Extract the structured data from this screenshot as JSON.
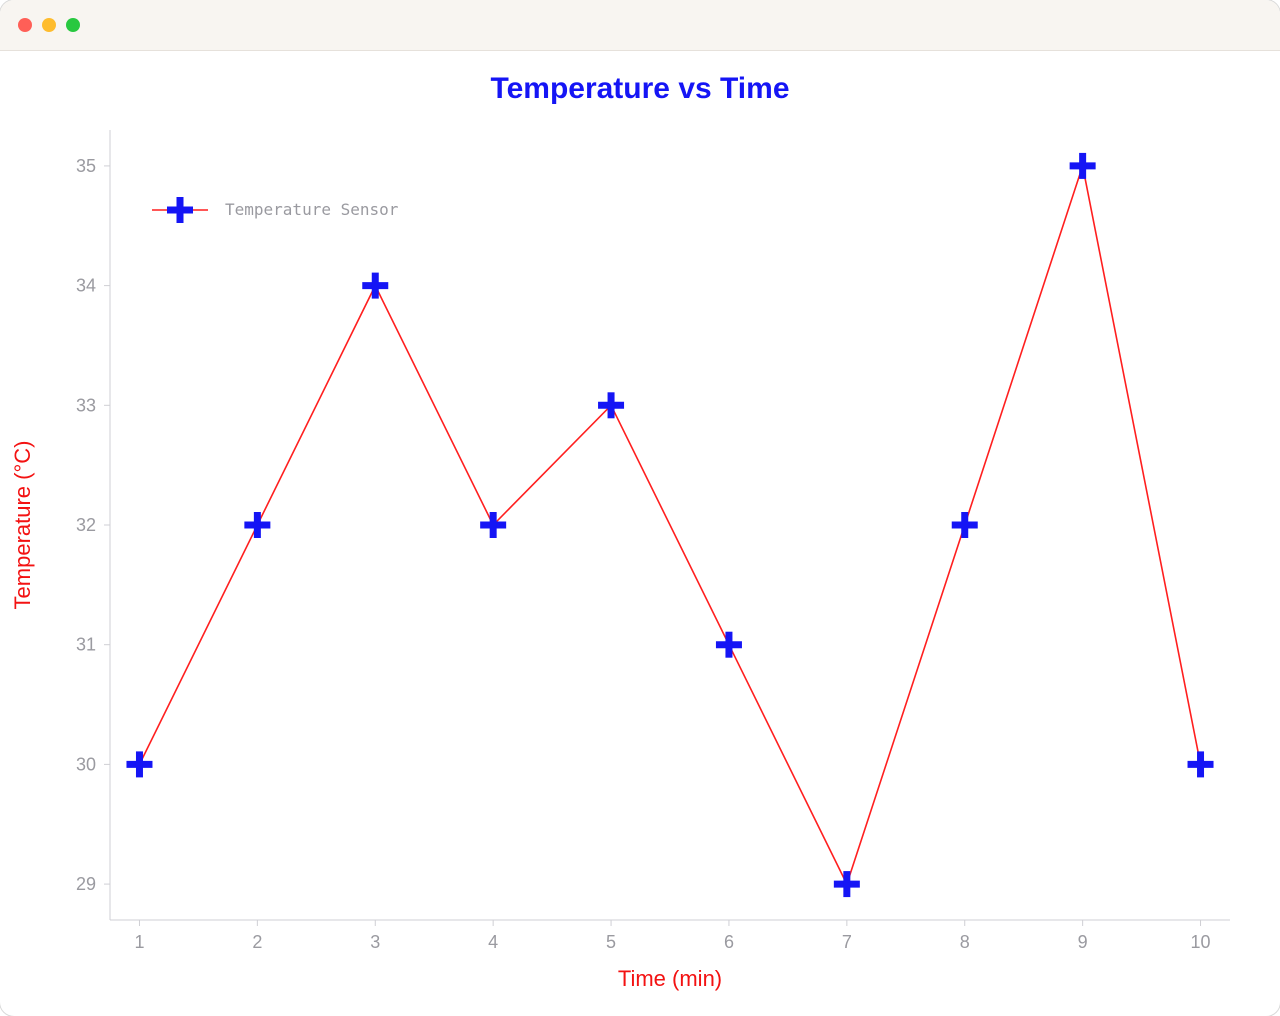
{
  "window": {
    "traffic_lights": {
      "close": "close",
      "minimize": "minimize",
      "maximize": "maximize"
    }
  },
  "chart_data": {
    "type": "line",
    "title": "Temperature vs Time",
    "xlabel": "Time (min)",
    "ylabel": "Temperature (°C)",
    "x_ticks": [
      1,
      2,
      3,
      4,
      5,
      6,
      7,
      8,
      9,
      10
    ],
    "y_ticks": [
      29,
      30,
      31,
      32,
      33,
      34,
      35
    ],
    "xlim": [
      1,
      10
    ],
    "ylim": [
      29,
      35
    ],
    "legend": {
      "position": "upper-left",
      "entries": [
        "Temperature Sensor"
      ]
    },
    "series": [
      {
        "name": "Temperature Sensor",
        "x": [
          1,
          2,
          3,
          4,
          5,
          6,
          7,
          8,
          9,
          10
        ],
        "values": [
          30,
          32,
          34,
          32,
          33,
          31,
          29,
          32,
          35,
          30
        ],
        "color_line": "#ff1f1f",
        "color_marker": "#1515f5",
        "marker": "plus"
      }
    ],
    "colors": {
      "title": "#1515f5",
      "axis_label": "#f31212",
      "tick": "#9a9aa0",
      "line": "#ff1f1f",
      "marker": "#1515f5"
    }
  }
}
